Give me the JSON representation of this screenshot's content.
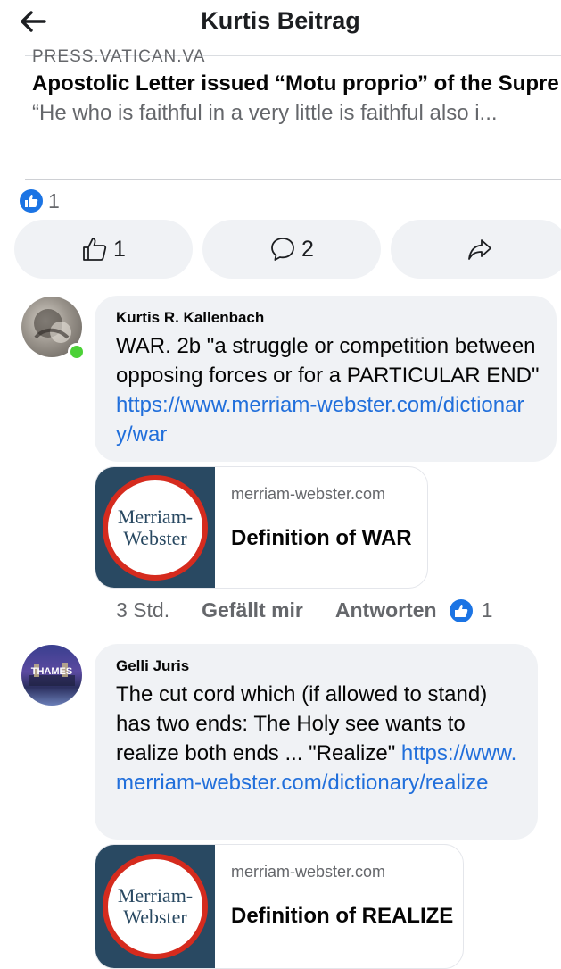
{
  "header": {
    "title": "Kurtis Beitrag"
  },
  "link_preview": {
    "domain": "PRESS.VATICAN.VA",
    "title": "Apostolic Letter issued “Motu proprio” of the Supreme Pontiff Francis on the instrumental legal...",
    "description": "“He who is faithful in a very little is faithful also i..."
  },
  "reactions": {
    "count": "1"
  },
  "actions": {
    "like_count": "1",
    "comment_count": "2"
  },
  "comments": [
    {
      "author": "Kurtis R. Kallenbach",
      "text": "WAR.  2b \"a struggle or competition between opposing forces or for a PARTICULAR END\" ",
      "link": "https://www.merriam-webster.com/dictionary/war",
      "card": {
        "domain": "merriam-webster.com",
        "title": "Definition of WAR"
      },
      "meta": {
        "time": "3 Std.",
        "like": "Gefällt mir",
        "reply": "Antworten",
        "reaction_count": "1"
      }
    },
    {
      "author": "Gelli Juris",
      "avatar_text": "THAMES",
      "text": "The cut cord which (if allowed to stand) has two ends: The Holy see wants to realize both ends ...  \"Realize\" ",
      "link": "https://www.merriam-webster.com/dictionary/realize",
      "card": {
        "domain": "merriam-webster.com",
        "title": "Definition of REALIZE"
      }
    }
  ],
  "card_logo": {
    "line1": "Merriam-",
    "line2": "Webster"
  },
  "colors": {
    "accent": "#1b74e4",
    "link": "#216fdb",
    "bubble": "#f0f2f5",
    "online": "#4cd137",
    "mw_blue": "#294962",
    "mw_red": "#d52b1e"
  }
}
